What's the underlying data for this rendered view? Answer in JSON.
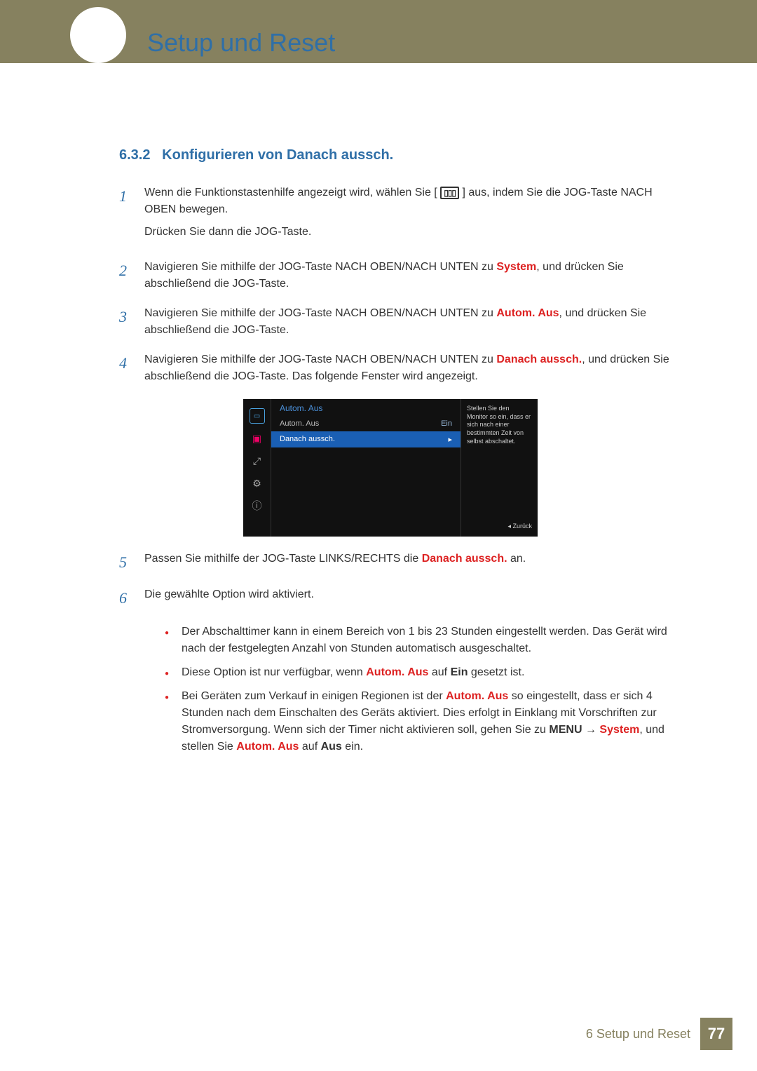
{
  "header": {
    "chapter_title": "Setup und Reset"
  },
  "section": {
    "number": "6.3.2",
    "title": "Konfigurieren von Danach aussch."
  },
  "steps": [
    {
      "num": "1",
      "p1_a": "Wenn die Funktionstastenhilfe angezeigt wird, wählen Sie [",
      "p1_b": "] aus, indem Sie die JOG-Taste NACH OBEN bewegen.",
      "p2": "Drücken Sie dann die JOG-Taste."
    },
    {
      "num": "2",
      "a": "Navigieren Sie mithilfe der JOG-Taste NACH OBEN/NACH UNTEN zu ",
      "hl": "System",
      "b": ", und drücken Sie abschließend die JOG-Taste."
    },
    {
      "num": "3",
      "a": "Navigieren Sie mithilfe der JOG-Taste NACH OBEN/NACH UNTEN zu ",
      "hl": "Autom. Aus",
      "b": ", und drücken Sie abschließend die JOG-Taste."
    },
    {
      "num": "4",
      "a": "Navigieren Sie mithilfe der JOG-Taste NACH OBEN/NACH UNTEN zu ",
      "hl": "Danach aussch.",
      "b": ", und drücken Sie abschließend die JOG-Taste. Das folgende Fenster wird angezeigt."
    },
    {
      "num": "5",
      "a": "Passen Sie mithilfe der JOG-Taste LINKS/RECHTS die ",
      "hl": "Danach aussch.",
      "b": " an."
    },
    {
      "num": "6",
      "a": "Die gewählte Option wird aktiviert."
    }
  ],
  "osd": {
    "title": "Autom. Aus",
    "row1_label": "Autom. Aus",
    "row1_value": "Ein",
    "row2_label": "Danach aussch.",
    "desc": "Stellen Sie den Monitor so ein, dass er sich nach einer bestimmten Zeit von selbst abschaltet.",
    "back": "◂    Zurück"
  },
  "notes": [
    {
      "text": "Der Abschalttimer kann in einem Bereich von 1 bis 23 Stunden eingestellt werden. Das Gerät wird nach der festgelegten Anzahl von Stunden automatisch ausgeschaltet."
    },
    {
      "a": "Diese Option ist nur verfügbar, wenn ",
      "hl1": "Autom. Aus",
      "mid": " auf ",
      "b1": "Ein",
      "tail": " gesetzt ist."
    },
    {
      "a": "Bei Geräten zum Verkauf in einigen Regionen ist der ",
      "hl1": "Autom. Aus",
      "b": " so eingestellt, dass er sich 4 Stunden nach dem Einschalten des Geräts aktiviert. Dies erfolgt in Einklang mit Vorschriften zur Stromversorgung. Wenn sich der Timer nicht aktivieren soll, gehen Sie zu ",
      "menu": "MENU",
      "arrow": " → ",
      "hl2": "System",
      "c": ", und stellen Sie ",
      "hl3": "Autom. Aus",
      "d": " auf ",
      "b2": "Aus",
      "e": " ein."
    }
  ],
  "footer": {
    "text": "6 Setup und Reset",
    "page": "77"
  }
}
